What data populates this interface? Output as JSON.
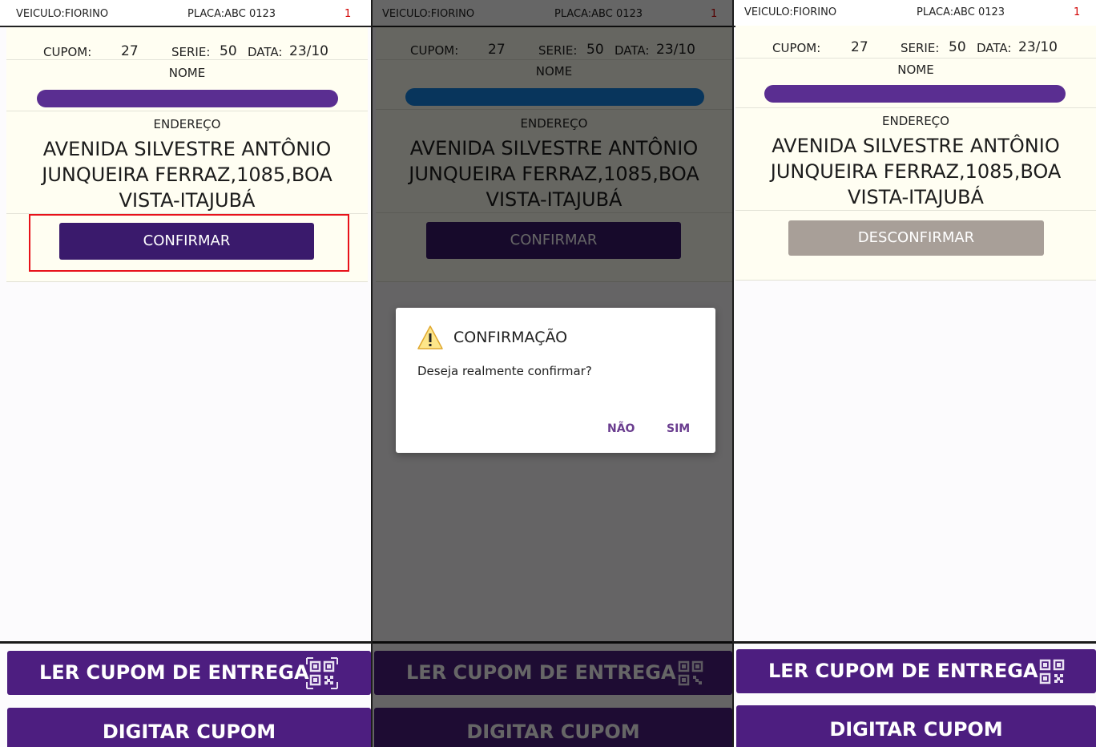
{
  "header": {
    "veiculo": "VEICULO:FIORINO",
    "placa": "PLACA:ABC 0123",
    "count": "1"
  },
  "coupon": {
    "cupom_label": "CUPOM:",
    "cupom_value": "27",
    "serie_label": "SERIE:",
    "serie_value": "50",
    "data_label": "DATA:",
    "data_value": "23/10",
    "nome_label": "NOME",
    "endereco_label": "ENDEREÇO",
    "address_line1": "AVENIDA SILVESTRE ANTÔNIO",
    "address_line2": "JUNQUEIRA FERRAZ,1085,BOA",
    "address_line3": "VISTA-ITAJUBÁ"
  },
  "buttons": {
    "confirm": "CONFIRMAR",
    "unconfirm": "DESCONFIRMAR",
    "read_coupon": "LER CUPOM DE ENTREGA",
    "type_coupon": "DIGITAR CUPOM"
  },
  "dialog": {
    "title": "CONFIRMAÇÃO",
    "message": "Deseja realmente confirmar?",
    "no": "NÃO",
    "yes": "SIM"
  },
  "colors": {
    "primary": "#4d1e80",
    "confirm_button": "#3a1a6c",
    "unconfirm_button": "#a89f98",
    "card_bg": "#fffef2",
    "highlight": "#e8121a",
    "redaction_purple": "#5a2e91",
    "redaction_blue": "#1586e6"
  },
  "icons": {
    "qr": "qr-code-icon",
    "warning": "warning-icon"
  }
}
